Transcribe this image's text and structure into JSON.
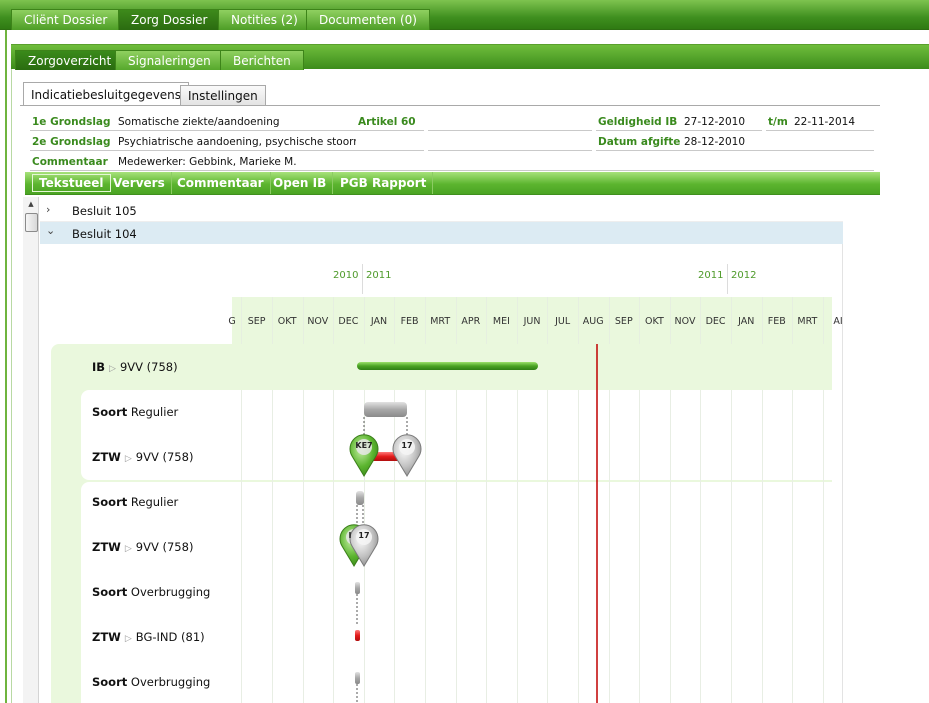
{
  "top_tabs": [
    {
      "label": "Cliënt Dossier",
      "active": false
    },
    {
      "label": "Zorg Dossier",
      "active": true
    },
    {
      "label": "Notities (2)",
      "active": false
    },
    {
      "label": "Documenten (0)",
      "active": false
    }
  ],
  "sub_tabs": [
    {
      "label": "Zorgoverzicht",
      "active": true
    },
    {
      "label": "Signaleringen",
      "active": false
    },
    {
      "label": "Berichten",
      "active": false
    }
  ],
  "detail_tabs": [
    {
      "label": "Indicatiebesluitgegevens",
      "active": true
    },
    {
      "label": "Instellingen",
      "active": false
    }
  ],
  "info": {
    "grondslag1_label": "1e Grondslag",
    "grondslag1_value": "Somatische ziekte/aandoening",
    "grondslag2_label": "2e Grondslag",
    "grondslag2_value": "Psychiatrische aandoening, psychische stoornis",
    "commentaar_label": "Commentaar",
    "commentaar_value": "Medewerker: Gebbink, Marieke M.",
    "artikel_label": "Artikel 60",
    "geldigheid_label": "Geldigheid IB",
    "geldigheid_value": "27-12-2010",
    "tm_label": "t/m",
    "tm_value": "22-11-2014",
    "afgifte_label": "Datum afgifte",
    "afgifte_value": "28-12-2010"
  },
  "toolbar": {
    "items": [
      "Tekstueel",
      "Ververs",
      "Commentaar",
      "Open IB",
      "PGB Rapport"
    ]
  },
  "tree": {
    "rows": [
      {
        "label": "Besluit 105",
        "expanded": false
      },
      {
        "label": "Besluit 104",
        "expanded": true
      }
    ]
  },
  "timeline": {
    "year_labels": [
      "2010",
      "2011",
      "2011",
      "2012"
    ],
    "months": [
      "G",
      "SEP",
      "OKT",
      "NOV",
      "DEC",
      "JAN",
      "FEB",
      "MRT",
      "APR",
      "MEI",
      "JUN",
      "JUL",
      "AUG",
      "SEP",
      "OKT",
      "NOV",
      "DEC",
      "JAN",
      "FEB",
      "MRT",
      "AI"
    ],
    "rows": [
      {
        "kind": "IB",
        "value": "9VV (758)"
      },
      {
        "kind": "Soort",
        "value": "Regulier"
      },
      {
        "kind": "ZTW",
        "value": "9VV (758)"
      },
      {
        "kind": "Soort",
        "value": "Regulier"
      },
      {
        "kind": "ZTW",
        "value": "9VV (758)"
      },
      {
        "kind": "Soort",
        "value": "Overbrugging"
      },
      {
        "kind": "ZTW",
        "value": "BG-IND (81)"
      },
      {
        "kind": "Soort",
        "value": "Overbrugging"
      }
    ],
    "markers": [
      {
        "label": "KE7",
        "color": "#5cb52f"
      },
      {
        "label": "17",
        "color": "#b5b5b5"
      },
      {
        "label": "I",
        "color": "#5cb52f"
      },
      {
        "label": "17",
        "color": "#b5b5b5"
      }
    ],
    "colors": {
      "ib_bar": "#4aa323",
      "soort_bar": "#a8a8a8",
      "ztw_bar_red": "#e31b1b",
      "today_line": "#c00000"
    }
  }
}
